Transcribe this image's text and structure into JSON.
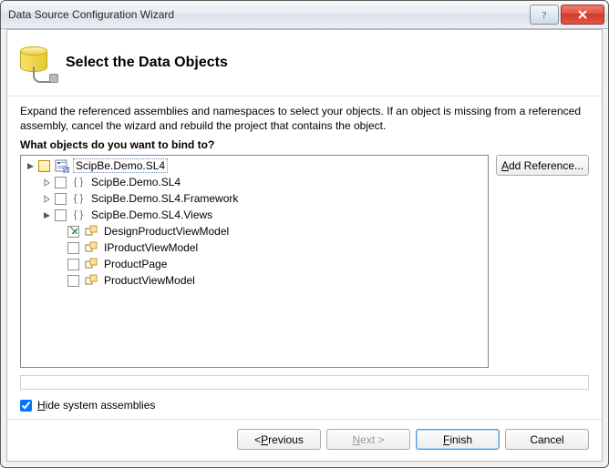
{
  "window": {
    "title": "Data Source Configuration Wizard"
  },
  "header": {
    "title": "Select the Data Objects"
  },
  "intro": "Expand the referenced assemblies and namespaces to select your objects. If an object is missing from a referenced assembly, cancel the wizard and rebuild the project that contains the object.",
  "bind_question": "What objects do you want to bind to?",
  "buttons": {
    "add_reference": "Add Reference...",
    "previous": "< Previous",
    "next": "Next >",
    "finish": "Finish",
    "cancel": "Cancel"
  },
  "hide_assemblies_label": "Hide system assemblies",
  "hide_assemblies_checked": true,
  "tree": {
    "root": {
      "label": "ScipBe.Demo.SL4",
      "expanded": true,
      "selected": true,
      "checked": false,
      "children": [
        {
          "label": "ScipBe.Demo.SL4",
          "type": "namespace",
          "expanded": false,
          "checked": false
        },
        {
          "label": "ScipBe.Demo.SL4.Framework",
          "type": "namespace",
          "expanded": false,
          "checked": false
        },
        {
          "label": "ScipBe.Demo.SL4.Views",
          "type": "namespace",
          "expanded": true,
          "checked": false,
          "children": [
            {
              "label": "DesignProductViewModel",
              "type": "class",
              "checked": true
            },
            {
              "label": "IProductViewModel",
              "type": "class",
              "checked": false
            },
            {
              "label": "ProductPage",
              "type": "class",
              "checked": false
            },
            {
              "label": "ProductViewModel",
              "type": "class",
              "checked": false
            }
          ]
        }
      ]
    }
  }
}
